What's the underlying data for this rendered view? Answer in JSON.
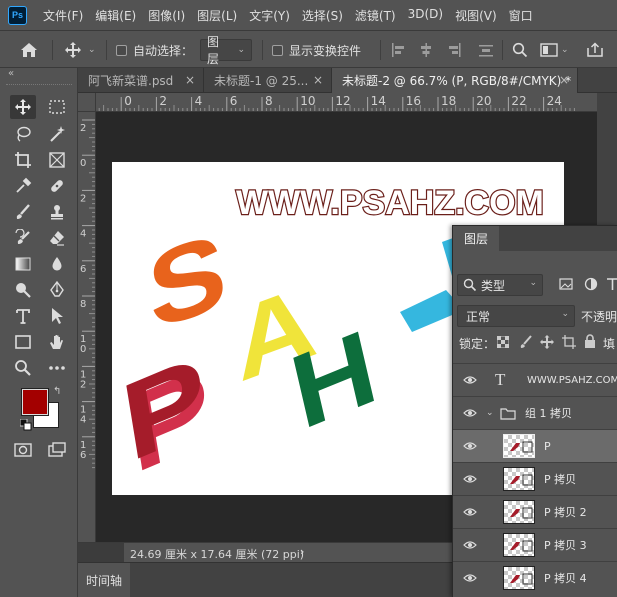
{
  "app": {
    "logo_text": "Ps"
  },
  "menu": [
    "文件(F)",
    "编辑(E)",
    "图像(I)",
    "图层(L)",
    "文字(Y)",
    "选择(S)",
    "滤镜(T)",
    "3D(D)",
    "视图(V)",
    "窗口"
  ],
  "options": {
    "auto_select_label": "自动选择：",
    "auto_select_value": "图层",
    "show_transform_label": "显示变换控件"
  },
  "tabs": [
    {
      "label": "阿飞新菜谱.psd"
    },
    {
      "label": "未标题-1 @ 25..."
    },
    {
      "label": "未标题-2 @ 66.7% (P, RGB/8#/CMYK) *"
    }
  ],
  "ruler": {
    "h_ticks": [
      "2",
      "0",
      "2",
      "4",
      "6",
      "8",
      "10",
      "12",
      "14",
      "16",
      "18",
      "20",
      "22",
      "24"
    ],
    "v_ticks": [
      "2",
      "0",
      "2",
      "4",
      "6",
      "8",
      "1\n0",
      "1\n2",
      "1\n4",
      "1\n6"
    ]
  },
  "canvas": {
    "watermark": "WWW.PSAHZ.COM",
    "letters": [
      "S",
      "A",
      "H",
      "P"
    ],
    "colors": {
      "S": "#e8631c",
      "A": "#f0e43a",
      "H": "#0d6e3c",
      "P": "#b61d2a",
      "accent": "#35b7df",
      "watermark_fill": "#ffffff",
      "watermark_stroke": "#6b1f1a"
    }
  },
  "status": {
    "doc_size": "24.69 厘米 x 17.64 厘米 (72 ppi)"
  },
  "timeline": {
    "label": "时间轴"
  },
  "layers_panel": {
    "tab_label": "图层",
    "filter_kind": "类型",
    "blend_mode": "正常",
    "opacity_label": "不透明",
    "lock_label": "锁定：",
    "fill_label": "填",
    "rows": [
      {
        "name": "WWW.PSAHZ.COM",
        "type": "text"
      },
      {
        "name": "组 1 拷贝",
        "type": "group"
      },
      {
        "name": "P",
        "type": "layer",
        "selected": true
      },
      {
        "name": "P 拷贝",
        "type": "layer"
      },
      {
        "name": "P 拷贝 2",
        "type": "layer"
      },
      {
        "name": "P 拷贝 3",
        "type": "layer"
      },
      {
        "name": "P 拷贝 4",
        "type": "layer"
      }
    ]
  },
  "colors": {
    "foreground": "#a30000",
    "background": "#ffffff",
    "ui_dark": "#535353",
    "pasteboard": "#282828"
  },
  "icons": [
    "home-icon",
    "move-icon",
    "align-icons",
    "search-icon",
    "workspace-icon",
    "share-icon"
  ]
}
